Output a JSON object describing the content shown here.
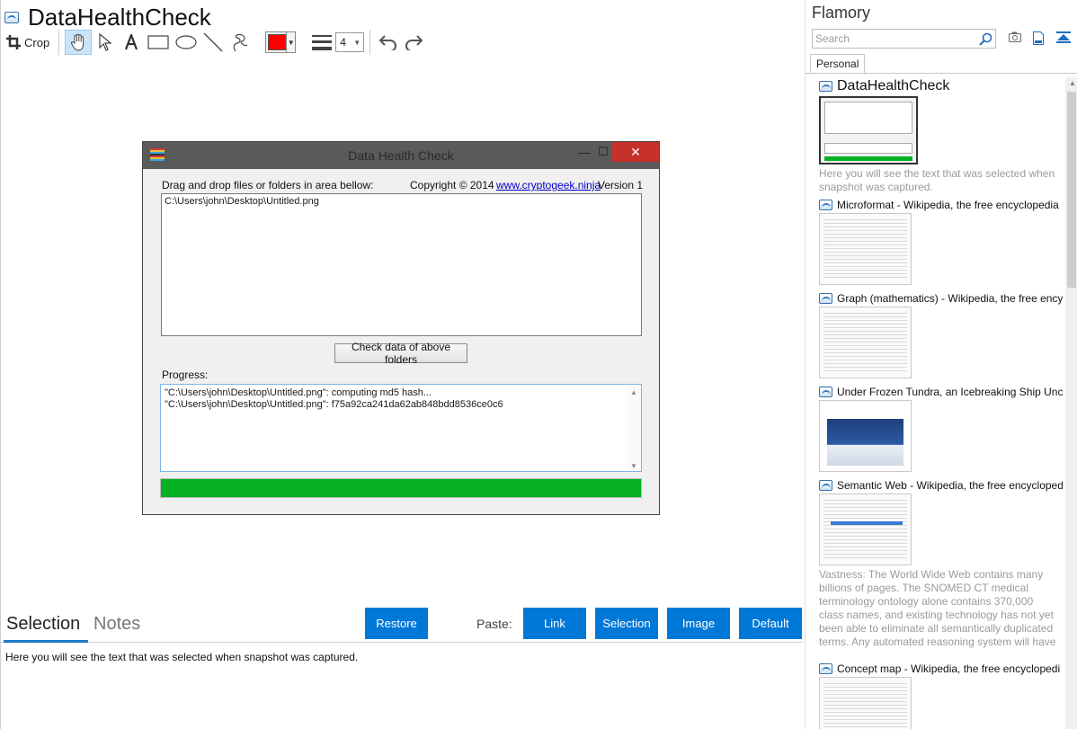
{
  "window": {
    "title": "DataHealthCheck"
  },
  "toolbar": {
    "crop_label": "Crop",
    "line_width": "4",
    "pen_color": "#ff0000"
  },
  "dialog": {
    "title": "Data Health Check",
    "drag_label": "Drag and drop files or folders in area bellow:",
    "copyright": "Copyright © 2014",
    "link": "www.cryptogeek.ninja",
    "version": "Version 1",
    "dropped_path": "C:\\Users\\john\\Desktop\\Untitled.png",
    "check_button": "Check data of above folders",
    "progress_label": "Progress:",
    "log": [
      "\"C:\\Users\\john\\Desktop\\Untitled.png\": computing md5 hash...",
      "\"C:\\Users\\john\\Desktop\\Untitled.png\": f75a92ca241da62ab848bdd8536ce0c6"
    ],
    "progress": 1.0,
    "progress_color": "#06b025"
  },
  "bottom": {
    "tabs": [
      "Selection",
      "Notes"
    ],
    "restore_label": "Restore",
    "paste_label": "Paste:",
    "paste_buttons": [
      "Link",
      "Selection",
      "Image",
      "Default"
    ],
    "selection_text": "Here you will see the text that was selected when snapshot was captured.",
    "accent_color": "#0078d7"
  },
  "sidebar": {
    "brand": "Flamory",
    "search_placeholder": "Search",
    "tab": "Personal",
    "items": [
      {
        "title": "DataHealthCheck",
        "desc": "Here you will see the text that was selected when snapshot was captured."
      },
      {
        "title": "Microformat - Wikipedia, the free encyclopedia",
        "desc": ""
      },
      {
        "title": "Graph (mathematics) - Wikipedia, the free ency",
        "desc": ""
      },
      {
        "title": "Under Frozen Tundra, an Icebreaking Ship Unco",
        "desc": ""
      },
      {
        "title": "Semantic Web - Wikipedia, the free encycloped",
        "desc": "Vastness: The World Wide Web contains many billions of pages. The SNOMED CT medical terminology ontology alone contains 370,000 class names, and existing technology has not yet been able to eliminate all semantically duplicated terms. Any automated reasoning system will have to deal with truly huge inputs."
      },
      {
        "title": "Concept map - Wikipedia, the free encyclopedi",
        "desc": ""
      }
    ]
  }
}
